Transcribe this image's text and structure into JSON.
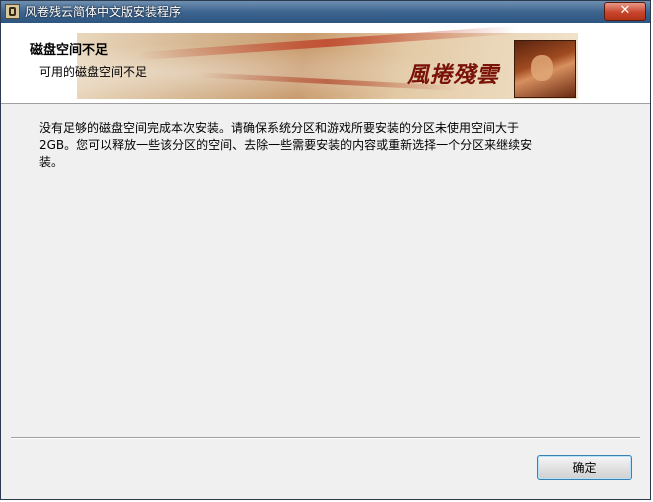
{
  "window": {
    "title": "风卷残云简体中文版安装程序",
    "close_glyph": "✕"
  },
  "header": {
    "title": "磁盘空间不足",
    "subtitle": "可用的磁盘空间不足",
    "banner_logo_text": "風捲殘雲"
  },
  "body": {
    "message_line1": "没有足够的磁盘空间完成本次安装。请确保系统分区和游戏所要安装的分区未使用空间大于",
    "message_line2": "2GB。您可以释放一些该分区的空间、去除一些需要安装的内容或重新选择一个分区来继续安",
    "message_line3": "装。"
  },
  "buttons": {
    "ok_label": "确定"
  }
}
